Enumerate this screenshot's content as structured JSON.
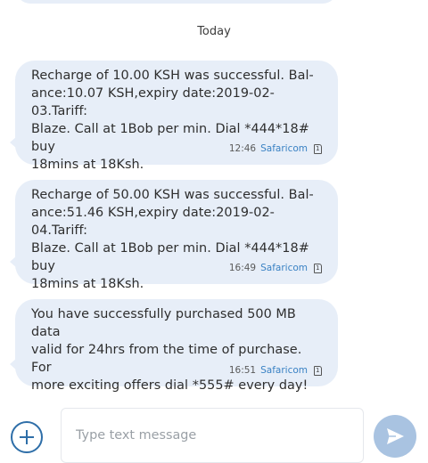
{
  "thread": {
    "date_separator": "Today"
  },
  "messages": [
    {
      "text": "Recharge of 10.00 KSH was successful. Bal-\nance:10.07 KSH,expiry date:2019-02-03.Tariff:\nBlaze. Call at 1Bob per min. Dial *444*18# buy\n18mins at 18Ksh.",
      "time": "12:46",
      "sender": "Safaricom",
      "sim_label": "1"
    },
    {
      "text": "Recharge of 50.00 KSH was successful. Bal-\nance:51.46 KSH,expiry date:2019-02-04.Tariff:\nBlaze. Call at 1Bob per min. Dial *444*18# buy\n18mins at 18Ksh.",
      "time": "16:49",
      "sender": "Safaricom",
      "sim_label": "1"
    },
    {
      "text": "You have successfully purchased 500 MB data\nvalid for 24hrs from the time of purchase. For\nmore exciting offers dial *555# every day!",
      "time": "16:51",
      "sender": "Safaricom",
      "sim_label": "1"
    }
  ],
  "compose": {
    "placeholder": "Type text message",
    "value": "",
    "add_icon": "plus-circle-icon",
    "send_icon": "send-icon"
  },
  "colors": {
    "bubble": "#e7eef8",
    "accent": "#2e6ea8",
    "sender": "#3a82c4",
    "send_button": "#a9c3e1"
  }
}
